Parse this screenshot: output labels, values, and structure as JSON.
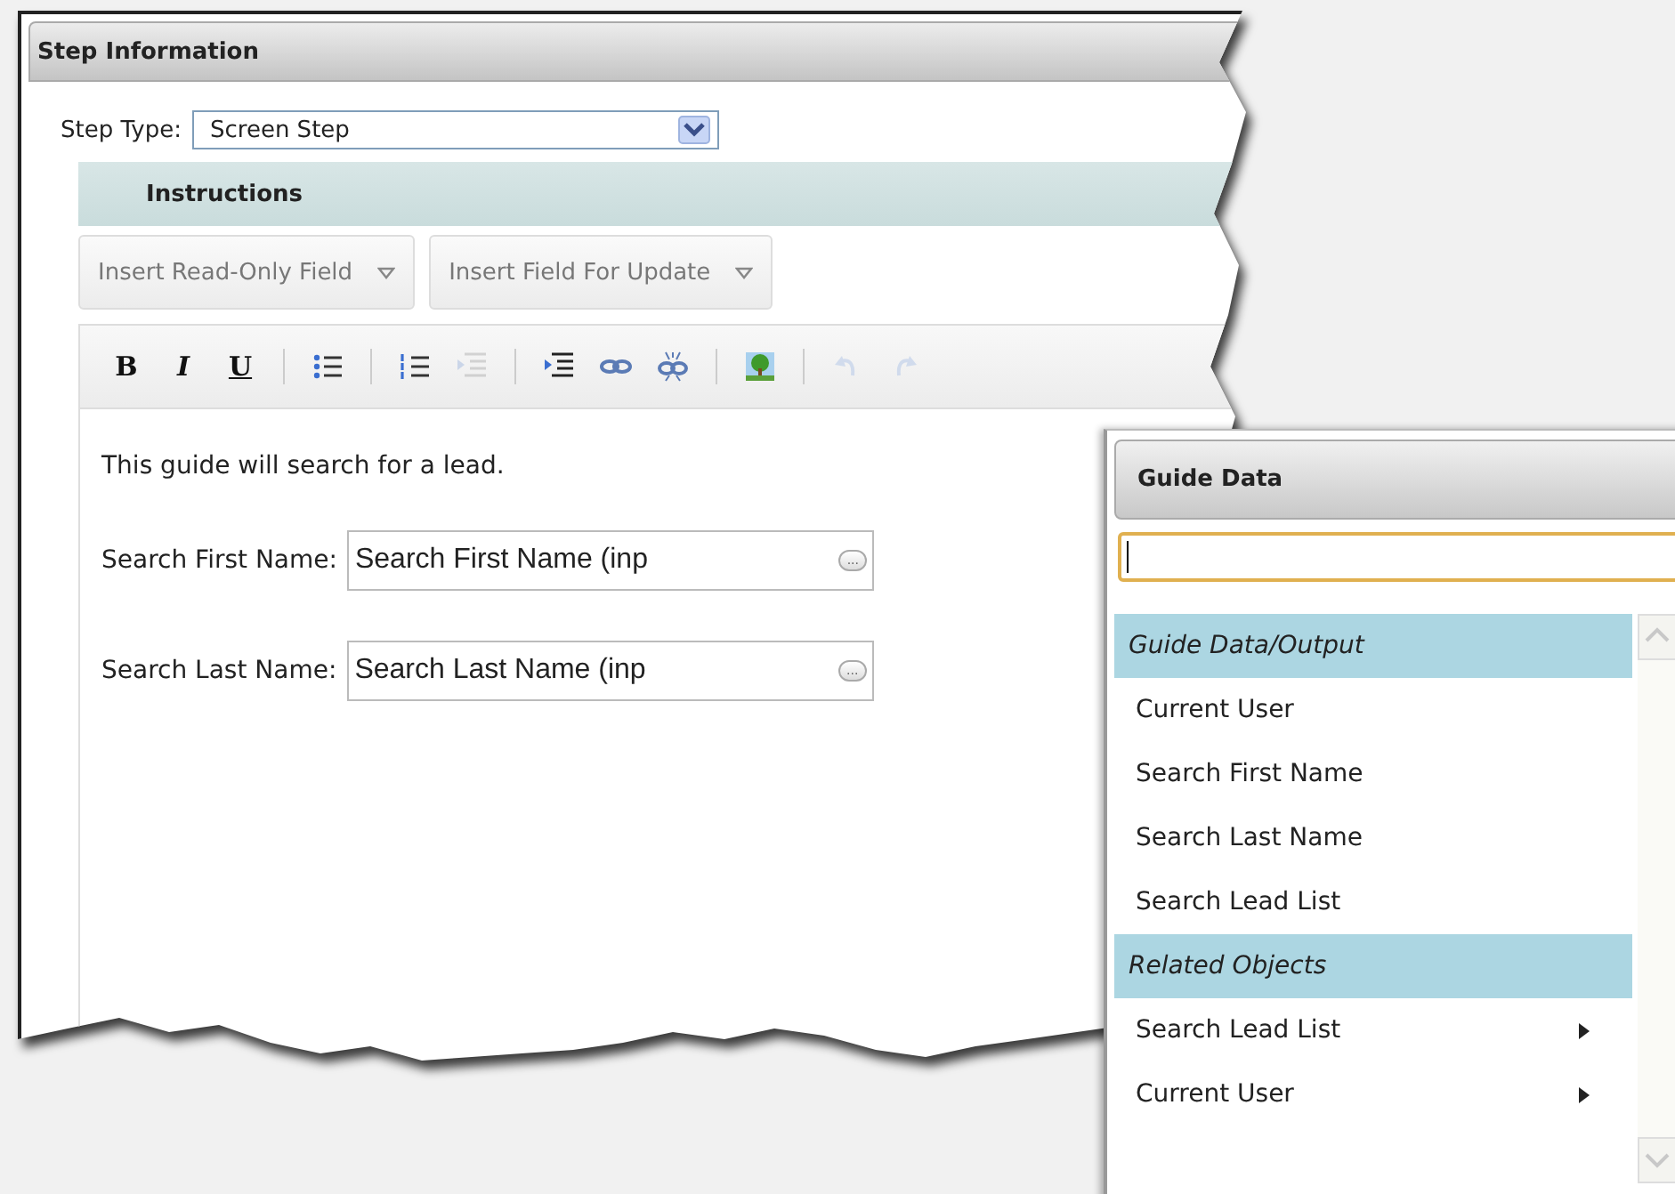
{
  "panel": {
    "title": "Step Information",
    "step_type": {
      "label": "Step Type:",
      "value": "Screen Step"
    },
    "section": {
      "title": "Instructions"
    },
    "insert_buttons": [
      {
        "label": "Insert Read-Only Field"
      },
      {
        "label": "Insert Field For Update"
      }
    ],
    "format_buttons": [
      {
        "label": "B",
        "kind": "bold"
      },
      {
        "label": "I",
        "kind": "italic"
      },
      {
        "label": "U",
        "kind": "underline"
      }
    ],
    "tools": [
      {
        "disabled": false
      },
      {
        "disabled": false
      },
      {
        "disabled": true
      },
      {
        "disabled": false
      },
      {
        "disabled": false
      },
      {
        "disabled": false
      },
      {
        "disabled": false
      },
      {
        "disabled": true
      },
      {
        "disabled": true
      }
    ],
    "editor": {
      "text": "This guide will search for a lead.",
      "fields": [
        {
          "label": "Search First Name:",
          "value": "Search First Name (inp",
          "button": "..."
        },
        {
          "label": "Search Last Name:",
          "value": "Search Last Name (inp",
          "button": "..."
        }
      ]
    }
  },
  "guide_data": {
    "title": "Guide Data",
    "items": [
      {
        "kind": "group",
        "label": "Guide Data/Output",
        "submenu": false
      },
      {
        "kind": "item",
        "label": "Current User",
        "submenu": false
      },
      {
        "kind": "item",
        "label": "Search First Name",
        "submenu": false
      },
      {
        "kind": "item",
        "label": "Search Last Name",
        "submenu": false
      },
      {
        "kind": "item",
        "label": "Search Lead List",
        "submenu": false
      },
      {
        "kind": "group",
        "label": "Related Objects",
        "submenu": false
      },
      {
        "kind": "item",
        "label": "Search Lead List",
        "submenu": true
      },
      {
        "kind": "item",
        "label": "Current User",
        "submenu": true
      }
    ]
  }
}
